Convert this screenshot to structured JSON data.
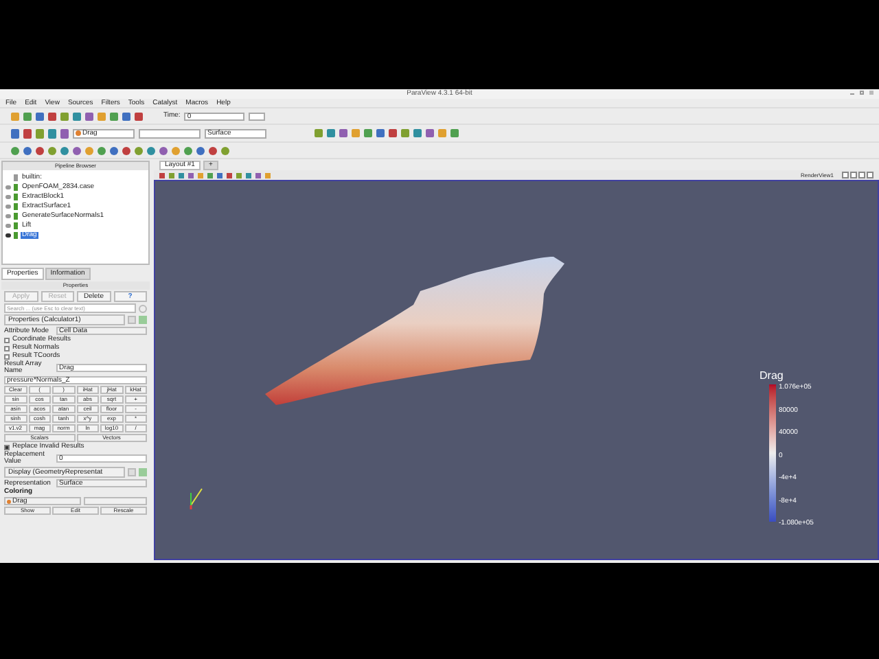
{
  "window": {
    "title": "ParaView 4.3.1 64-bit"
  },
  "menu": [
    "File",
    "Edit",
    "View",
    "Sources",
    "Filters",
    "Tools",
    "Catalyst",
    "Macros",
    "Help"
  ],
  "time": {
    "label": "Time:",
    "value": "0"
  },
  "toolbar_dropdowns": [
    {
      "kind": "array",
      "value": "Drag"
    },
    {
      "kind": "plain"
    },
    {
      "kind": "plain",
      "value": "Surface"
    }
  ],
  "pipeline": {
    "title": "Pipeline Browser",
    "items": [
      {
        "label": "builtin:",
        "kind": "server",
        "selected": false
      },
      {
        "label": "OpenFOAM_2834.case",
        "kind": "source",
        "selected": false
      },
      {
        "label": "ExtractBlock1",
        "kind": "source",
        "selected": false
      },
      {
        "label": "ExtractSurface1",
        "kind": "source",
        "selected": false
      },
      {
        "label": "GenerateSurfaceNormals1",
        "kind": "source",
        "selected": false
      },
      {
        "label": "Lift",
        "kind": "source",
        "selected": false
      },
      {
        "label": "Drag",
        "kind": "source",
        "selected": true
      }
    ]
  },
  "panel_tabs": [
    {
      "label": "Properties",
      "selected": true
    },
    {
      "label": "Information",
      "selected": false
    }
  ],
  "properties": {
    "title": "Properties",
    "buttons": [
      {
        "label": "Apply",
        "kind": "apply",
        "disabled": true
      },
      {
        "label": "Reset",
        "kind": "reset",
        "disabled": true
      },
      {
        "label": "Delete",
        "kind": "delete",
        "disabled": false
      },
      {
        "label": "?",
        "kind": "help",
        "disabled": false
      }
    ],
    "search_placeholder": "Search ... (use Esc to clear text)",
    "section": "Properties (Calculator1)",
    "attribute_mode": {
      "label": "Attribute Mode",
      "value": "Cell Data"
    },
    "checkboxes": [
      {
        "label": "Coordinate Results",
        "checked": false
      },
      {
        "label": "Result Normals",
        "checked": false
      },
      {
        "label": "Result TCoords",
        "checked": false
      }
    ],
    "result_array": {
      "label": "Result Array Name",
      "value": "Drag"
    },
    "expression": "pressure*Normals_Z",
    "keys": [
      [
        "Clear",
        "(",
        ")",
        "iHat",
        "jHat",
        "kHat"
      ],
      [
        "sin",
        "cos",
        "tan",
        "abs",
        "sqrt",
        "+"
      ],
      [
        "asin",
        "acos",
        "atan",
        "ceil",
        "floor",
        "-"
      ],
      [
        "sinh",
        "cosh",
        "tanh",
        "x^y",
        "exp",
        "*"
      ],
      [
        "v1.v2",
        "mag",
        "norm",
        "ln",
        "log10",
        "/"
      ]
    ],
    "vector_menus": [
      "Scalars",
      "Vectors"
    ],
    "replace_invalid": {
      "label": "Replace Invalid Results",
      "checked": true
    },
    "replacement": {
      "label": "Replacement Value",
      "value": "0"
    },
    "display_section": "Display (GeometryRepresentat",
    "representation": {
      "label": "Representation",
      "value": "Surface"
    },
    "coloring": {
      "label": "Coloring",
      "value": "Drag"
    },
    "color_buttons": [
      "Show",
      "Edit",
      "Rescale"
    ]
  },
  "layout_tabs": [
    {
      "label": "Layout #1",
      "selected": true
    },
    {
      "label": "+",
      "selected": false
    }
  ],
  "view_name": "RenderView1",
  "legend": {
    "title": "Drag",
    "labels": [
      "1.076e+05",
      "80000",
      "40000",
      "0",
      "-4e+4",
      "-8e+4",
      "-1.080e+05"
    ]
  }
}
